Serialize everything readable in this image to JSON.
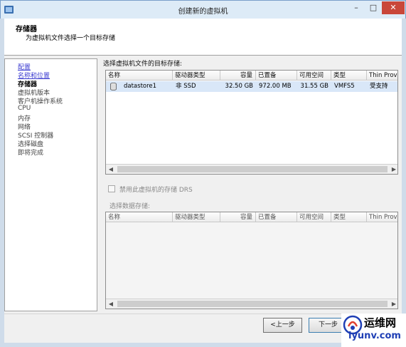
{
  "window": {
    "title": "创建新的虚拟机",
    "minimize": "–",
    "maximize": "□",
    "close": "✕"
  },
  "header": {
    "title": "存储器",
    "subtitle": "为虚拟机文件选择一个目标存储"
  },
  "nav": {
    "items": [
      {
        "label": "配置",
        "state": "link"
      },
      {
        "label": "名称和位置",
        "state": "link"
      },
      {
        "label": "存储器",
        "state": "current"
      },
      {
        "label": "虚拟机版本",
        "state": "pending"
      },
      {
        "label": "客户机操作系统",
        "state": "pending"
      },
      {
        "label": "CPU",
        "state": "pending"
      },
      {
        "label": "内存",
        "state": "pending"
      },
      {
        "label": "网络",
        "state": "pending"
      },
      {
        "label": "SCSI 控制器",
        "state": "pending"
      },
      {
        "label": "选择磁盘",
        "state": "pending"
      },
      {
        "label": "即将完成",
        "state": "pending"
      }
    ]
  },
  "target_storage": {
    "label": "选择虚拟机文件的目标存储:",
    "columns": [
      "名称",
      "驱动器类型",
      "容量",
      "已置备",
      "可用空间",
      "类型",
      "Thin Provi"
    ],
    "rows": [
      {
        "name": "datastore1",
        "drive_type": "非 SSD",
        "capacity": "32.50 GB",
        "provisioned": "972.00 MB",
        "free": "31.55 GB",
        "type": "VMFS5",
        "thin": "受支持"
      }
    ]
  },
  "drs": {
    "label": "禁用此虚拟机的存储 DRS",
    "checked": false
  },
  "datastore_select": {
    "label": "选择数据存储:",
    "columns": [
      "名称",
      "驱动器类型",
      "容量",
      "已置备",
      "可用空间",
      "类型",
      "Thin Provi"
    ]
  },
  "buttons": {
    "back": "<上一步",
    "next": "下一步"
  },
  "watermark": {
    "name": "运维网",
    "url": "iyunv.com"
  }
}
